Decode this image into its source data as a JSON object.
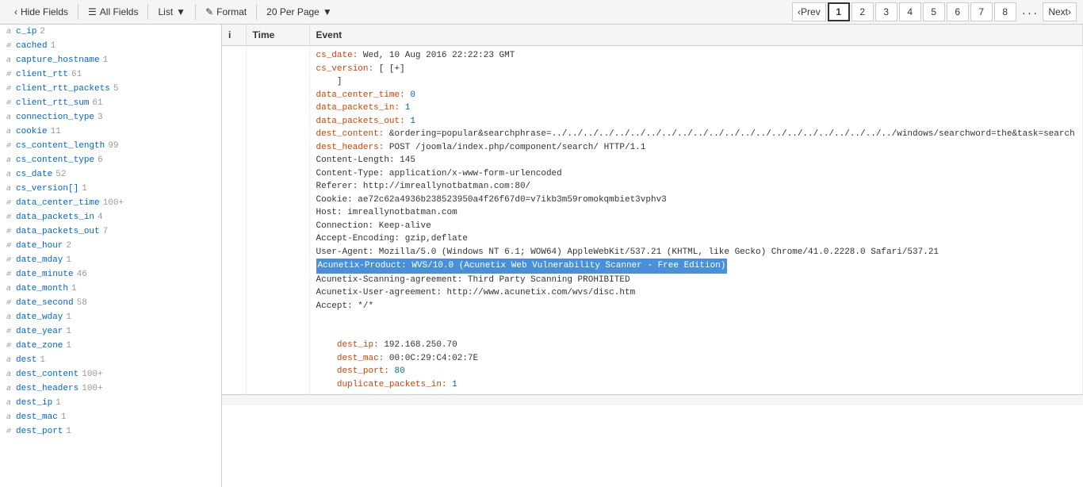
{
  "toolbar": {
    "hide_fields_label": "Hide Fields",
    "all_fields_label": "All Fields",
    "list_label": "List",
    "format_label": "Format",
    "per_page_label": "20 Per Page"
  },
  "pagination": {
    "prev_label": "Prev",
    "next_label": "Next",
    "pages": [
      "1",
      "2",
      "3",
      "4",
      "5",
      "6",
      "7",
      "8"
    ],
    "active_page": "1",
    "ellipsis": "..."
  },
  "table": {
    "col_i": "i",
    "col_time": "Time",
    "col_event": "Event"
  },
  "sidebar": {
    "items": [
      {
        "type": "a",
        "name": "c_ip",
        "count": "2"
      },
      {
        "type": "#",
        "name": "cached",
        "count": "1"
      },
      {
        "type": "a",
        "name": "capture_hostname",
        "count": "1"
      },
      {
        "type": "#",
        "name": "client_rtt",
        "count": "61"
      },
      {
        "type": "#",
        "name": "client_rtt_packets",
        "count": "5"
      },
      {
        "type": "#",
        "name": "client_rtt_sum",
        "count": "61"
      },
      {
        "type": "a",
        "name": "connection_type",
        "count": "3"
      },
      {
        "type": "a",
        "name": "cookie",
        "count": "11"
      },
      {
        "type": "#",
        "name": "cs_content_length",
        "count": "99"
      },
      {
        "type": "a",
        "name": "cs_content_type",
        "count": "6"
      },
      {
        "type": "a",
        "name": "cs_date",
        "count": "52"
      },
      {
        "type": "a",
        "name": "cs_version[]",
        "count": "1"
      },
      {
        "type": "#",
        "name": "data_center_time",
        "count": "100+"
      },
      {
        "type": "#",
        "name": "data_packets_in",
        "count": "4"
      },
      {
        "type": "#",
        "name": "data_packets_out",
        "count": "7"
      },
      {
        "type": "#",
        "name": "date_hour",
        "count": "2"
      },
      {
        "type": "#",
        "name": "date_mday",
        "count": "1"
      },
      {
        "type": "#",
        "name": "date_minute",
        "count": "46"
      },
      {
        "type": "a",
        "name": "date_month",
        "count": "1"
      },
      {
        "type": "#",
        "name": "date_second",
        "count": "58"
      },
      {
        "type": "a",
        "name": "date_wday",
        "count": "1"
      },
      {
        "type": "#",
        "name": "date_year",
        "count": "1"
      },
      {
        "type": "#",
        "name": "date_zone",
        "count": "1"
      },
      {
        "type": "a",
        "name": "dest",
        "count": "1"
      },
      {
        "type": "a",
        "name": "dest_content",
        "count": "100+"
      },
      {
        "type": "a",
        "name": "dest_headers",
        "count": "100+"
      },
      {
        "type": "a",
        "name": "dest_ip",
        "count": "1"
      },
      {
        "type": "a",
        "name": "dest_mac",
        "count": "1"
      },
      {
        "type": "#",
        "name": "dest_port",
        "count": "1"
      }
    ]
  },
  "event_lines": [
    {
      "type": "key-val",
      "key": "cs_date:",
      "val": " Wed, 10 Aug 2016 22:22:23 GMT"
    },
    {
      "type": "key-val",
      "key": "cs_version:",
      "val": " [ [+]"
    },
    {
      "type": "plain",
      "text": "    ]"
    },
    {
      "type": "key-val-num",
      "key": "data_center_time:",
      "val": " 0"
    },
    {
      "type": "key-val-num",
      "key": "data_packets_in:",
      "val": " 1"
    },
    {
      "type": "key-val-num",
      "key": "data_packets_out:",
      "val": " 1"
    },
    {
      "type": "key-val",
      "key": "dest_content:",
      "val": " &ordering=popular&searchphrase=../../../../../../../../../../../../../../../../../../../../../../windows/searchword=the&task=search"
    },
    {
      "type": "key-val",
      "key": "dest_headers:",
      "val": " POST /joomla/index.php/component/search/ HTTP/1.1"
    },
    {
      "type": "plain",
      "text": "Content-Length: 145"
    },
    {
      "type": "plain",
      "text": "Content-Type: application/x-www-form-urlencoded"
    },
    {
      "type": "plain",
      "text": "Referer: http://imreallynotbatman.com:80/"
    },
    {
      "type": "plain",
      "text": "Cookie: ae72c62a4936b238523950a4f26f67d0=v7ikb3m59romokqmbiet3vphv3"
    },
    {
      "type": "plain",
      "text": "Host: imreallynotbatman.com"
    },
    {
      "type": "plain",
      "text": "Connection: Keep-alive"
    },
    {
      "type": "plain",
      "text": "Accept-Encoding: gzip,deflate"
    },
    {
      "type": "plain",
      "text": "User-Agent: Mozilla/5.0 (Windows NT 6.1; WOW64) AppleWebKit/537.21 (KHTML, like Gecko) Chrome/41.0.2228.0 Safari/537.21"
    },
    {
      "type": "highlight",
      "text": "Acunetix-Product: WVS/10.0 (Acunetix Web Vulnerability Scanner - Free Edition)"
    },
    {
      "type": "plain",
      "text": "Acunetix-Scanning-agreement: Third Party Scanning PROHIBITED"
    },
    {
      "type": "plain",
      "text": "Acunetix-User-agreement: http://www.acunetix.com/wvs/disc.htm"
    },
    {
      "type": "plain",
      "text": "Accept: */*"
    },
    {
      "type": "plain",
      "text": ""
    },
    {
      "type": "plain",
      "text": ""
    },
    {
      "type": "key-val",
      "key": "    dest_ip:",
      "val": " 192.168.250.70"
    },
    {
      "type": "key-val",
      "key": "    dest_mac:",
      "val": " 00:0C:29:C4:02:7E"
    },
    {
      "type": "key-val-num",
      "key": "    dest_port:",
      "val": " 80"
    },
    {
      "type": "key-val-num",
      "key": "    duplicate_packets_in:",
      "val": " 1"
    }
  ]
}
